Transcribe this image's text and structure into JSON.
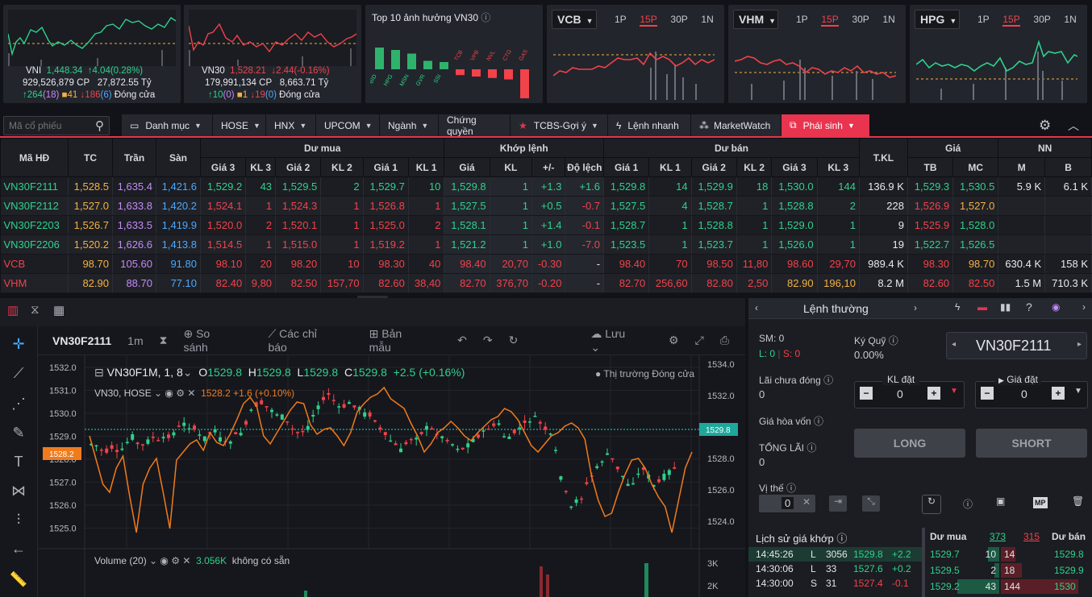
{
  "colors": {
    "up": "#2fd18c",
    "down": "#f2424a",
    "ref": "#f5b142",
    "ceil": "#c58af9",
    "floor": "#4aa8ff",
    "accent": "#e8344e"
  },
  "indices": [
    {
      "name": "VNI",
      "price": "1,448.34",
      "change": "↑4.04(0.28%)",
      "vol": "929,526,879",
      "vol_unit": "CP",
      "val": "27,872.55",
      "val_unit": "Tỷ",
      "adv": "↑264",
      "adv_c": "(18)",
      "ref": "■41",
      "dec": "↓186",
      "dec_f": "(6)",
      "status": "Đóng cửa"
    },
    {
      "name": "VN30",
      "price": "1,528.21",
      "change": "↓2.44(-0.16%)",
      "vol": "179,991,134",
      "vol_unit": "CP",
      "val": "8,663.71",
      "val_unit": "Tỷ",
      "adv": "↑10",
      "adv_c": "(0)",
      "ref": "■1",
      "dec": "↓19",
      "dec_f": "(0)",
      "status": "Đóng cửa"
    }
  ],
  "top10": {
    "title": "Top 10 ảnh hưởng VN30",
    "pos": [
      "BID",
      "HPG",
      "MSN",
      "GVR",
      "SSI"
    ],
    "neg": [
      "TCB",
      "VPB",
      "NVL",
      "CTG",
      "GAS"
    ],
    "pos_vals": [
      0.9,
      0.8,
      0.65,
      0.35,
      0.3
    ],
    "neg_vals": [
      0.2,
      0.25,
      0.3,
      0.35,
      1.0
    ]
  },
  "mini": [
    {
      "sym": "VCB",
      "tf": [
        "1P",
        "15P",
        "30P",
        "1N"
      ],
      "active": "15P"
    },
    {
      "sym": "VHM",
      "tf": [
        "1P",
        "15P",
        "30P",
        "1N"
      ],
      "active": "15P"
    },
    {
      "sym": "HPG",
      "tf": [
        "1P",
        "15P",
        "30P",
        "1N"
      ],
      "active": "15P"
    }
  ],
  "toolbar": {
    "search_ph": "Mã cổ phiếu",
    "items": [
      "Danh mục",
      "HOSE",
      "HNX",
      "UPCOM",
      "Ngành",
      "Chứng quyền",
      "TCBS-Gợi ý",
      "Lệnh nhanh",
      "MarketWatch",
      "Phái sinh"
    ]
  },
  "table": {
    "groups": {
      "mahd": "Mã HĐ",
      "tc": "TC",
      "tran": "Trần",
      "san": "Sàn",
      "dumua": "Dư mua",
      "khop": "Khớp lệnh",
      "duban": "Dư bán",
      "tkl": "T.KL",
      "gia": "Giá",
      "nn": "NN"
    },
    "sub": [
      "Giá 3",
      "KL 3",
      "Giá 2",
      "KL 2",
      "Giá 1",
      "KL 1",
      "Giá",
      "KL",
      "+/-",
      "Độ lệch",
      "Giá 1",
      "KL 1",
      "Giá 2",
      "KL 2",
      "Giá 3",
      "KL 3",
      "TB",
      "MC",
      "M",
      "B"
    ],
    "rows": [
      [
        "VN30F2111",
        "1,528.5",
        "1,635.4",
        "1,421.6",
        "1,529.2",
        "43",
        "1,529.5",
        "2",
        "1,529.7",
        "10",
        "1,529.8",
        "1",
        "+1.3",
        "+1.6",
        "1,529.8",
        "14",
        "1,529.9",
        "18",
        "1,530.0",
        "144",
        "136.9 K",
        "1,529.3",
        "1,530.5",
        "5.9 K",
        "6.1 K"
      ],
      [
        "VN30F2112",
        "1,527.0",
        "1,633.8",
        "1,420.2",
        "1,524.1",
        "1",
        "1,524.3",
        "1",
        "1,526.8",
        "1",
        "1,527.5",
        "1",
        "+0.5",
        "-0.7",
        "1,527.5",
        "4",
        "1,528.7",
        "1",
        "1,528.8",
        "2",
        "228",
        "1,526.9",
        "1,527.0",
        "",
        ""
      ],
      [
        "VN30F2203",
        "1,526.7",
        "1,633.5",
        "1,419.9",
        "1,520.0",
        "2",
        "1,520.1",
        "1",
        "1,525.0",
        "2",
        "1,528.1",
        "1",
        "+1.4",
        "-0.1",
        "1,528.7",
        "1",
        "1,528.8",
        "1",
        "1,529.0",
        "1",
        "9",
        "1,525.9",
        "1,528.0",
        "",
        ""
      ],
      [
        "VN30F2206",
        "1,520.2",
        "1,626.6",
        "1,413.8",
        "1,514.5",
        "1",
        "1,515.0",
        "1",
        "1,519.2",
        "1",
        "1,521.2",
        "1",
        "+1.0",
        "-7.0",
        "1,523.5",
        "1",
        "1,523.7",
        "1",
        "1,526.0",
        "1",
        "19",
        "1,522.7",
        "1,526.5",
        "",
        ""
      ],
      [
        "VCB",
        "98.70",
        "105.60",
        "91.80",
        "98.10",
        "20",
        "98.20",
        "10",
        "98.30",
        "40",
        "98.40",
        "20,70",
        "-0.30",
        "-",
        "98.40",
        "70",
        "98.50",
        "11,80",
        "98.60",
        "29,70",
        "989.4 K",
        "98.30",
        "98.70",
        "630.4 K",
        "158 K"
      ],
      [
        "VHM",
        "82.90",
        "88.70",
        "77.10",
        "82.40",
        "9,80",
        "82.50",
        "157,70",
        "82.60",
        "38,40",
        "82.70",
        "376,70",
        "-0.20",
        "-",
        "82.70",
        "256,60",
        "82.80",
        "2,50",
        "82.90",
        "196,10",
        "8.2 M",
        "82.60",
        "82.50",
        "1.5 M",
        "710.3 K"
      ]
    ]
  },
  "chart": {
    "symbol": "VN30F2111",
    "tf": "1m",
    "compare": "So sánh",
    "indicators": "Các chỉ báo",
    "template": "Bản mẫu",
    "save": "Lưu",
    "legend": "VN30F1M, 1, 8",
    "o": "1529.8",
    "h": "1529.8",
    "l": "1529.8",
    "c": "1529.8",
    "chg": "+2.5 (+0.16%)",
    "status": "Thị trường Đóng cửa",
    "ovl": "VN30, HOSE",
    "ovl_val": "1528.2",
    "ovl_chg": "+1.6 (+0.10%)",
    "yl": [
      "1532.0",
      "1531.0",
      "1530.0",
      "1529.0",
      "1528.0",
      "1527.0",
      "1526.0",
      "1525.0"
    ],
    "yr": [
      "1534.0",
      "1532.0",
      "1530.0",
      "1528.0",
      "1526.0",
      "1524.0"
    ],
    "last_r": "1529.8",
    "last_l": "1528.2",
    "vol_label": "Volume (20)",
    "vol_val": "3.056K",
    "vol_na": "không có sẵn",
    "vyr": [
      "3K",
      "2K"
    ]
  },
  "order": {
    "title": "Lệnh thường",
    "sm": "SM: 0",
    "l": "L: 0",
    "s": "S: 0",
    "kyquy": "Ký Quỹ",
    "kyquy_val": "0.00%",
    "symbol": "VN30F2111",
    "laichua": "Lãi chưa đóng",
    "laichua_val": "0",
    "kldat": "KL đặt",
    "kldat_val": "0",
    "giadat": "Giá đặt",
    "giadat_val": "0",
    "giahoavon": "Giá hòa vốn",
    "tonglai": "TỔNG LÃI",
    "tonglai_val": "0",
    "long": "LONG",
    "short": "SHORT",
    "vithe": "Vị thế",
    "vithe_val": "0"
  },
  "history": {
    "title": "Lịch sử giá khớp",
    "rows": [
      [
        "14:45:26",
        "L",
        "3056",
        "1529.8",
        "+2.2"
      ],
      [
        "14:30:06",
        "L",
        "33",
        "1527.6",
        "+0.2"
      ],
      [
        "14:30:00",
        "S",
        "31",
        "1527.4",
        "-0.1"
      ]
    ]
  },
  "depth": {
    "h_buy": "Dư mua",
    "buy_tot": "373",
    "sell_tot": "315",
    "h_sell": "Dư bán",
    "rows": [
      [
        "1529.7",
        "10",
        "14",
        "1529.8"
      ],
      [
        "1529.5",
        "2",
        "18",
        "1529.9"
      ],
      [
        "1529.2",
        "43",
        "144",
        "1530"
      ]
    ]
  }
}
